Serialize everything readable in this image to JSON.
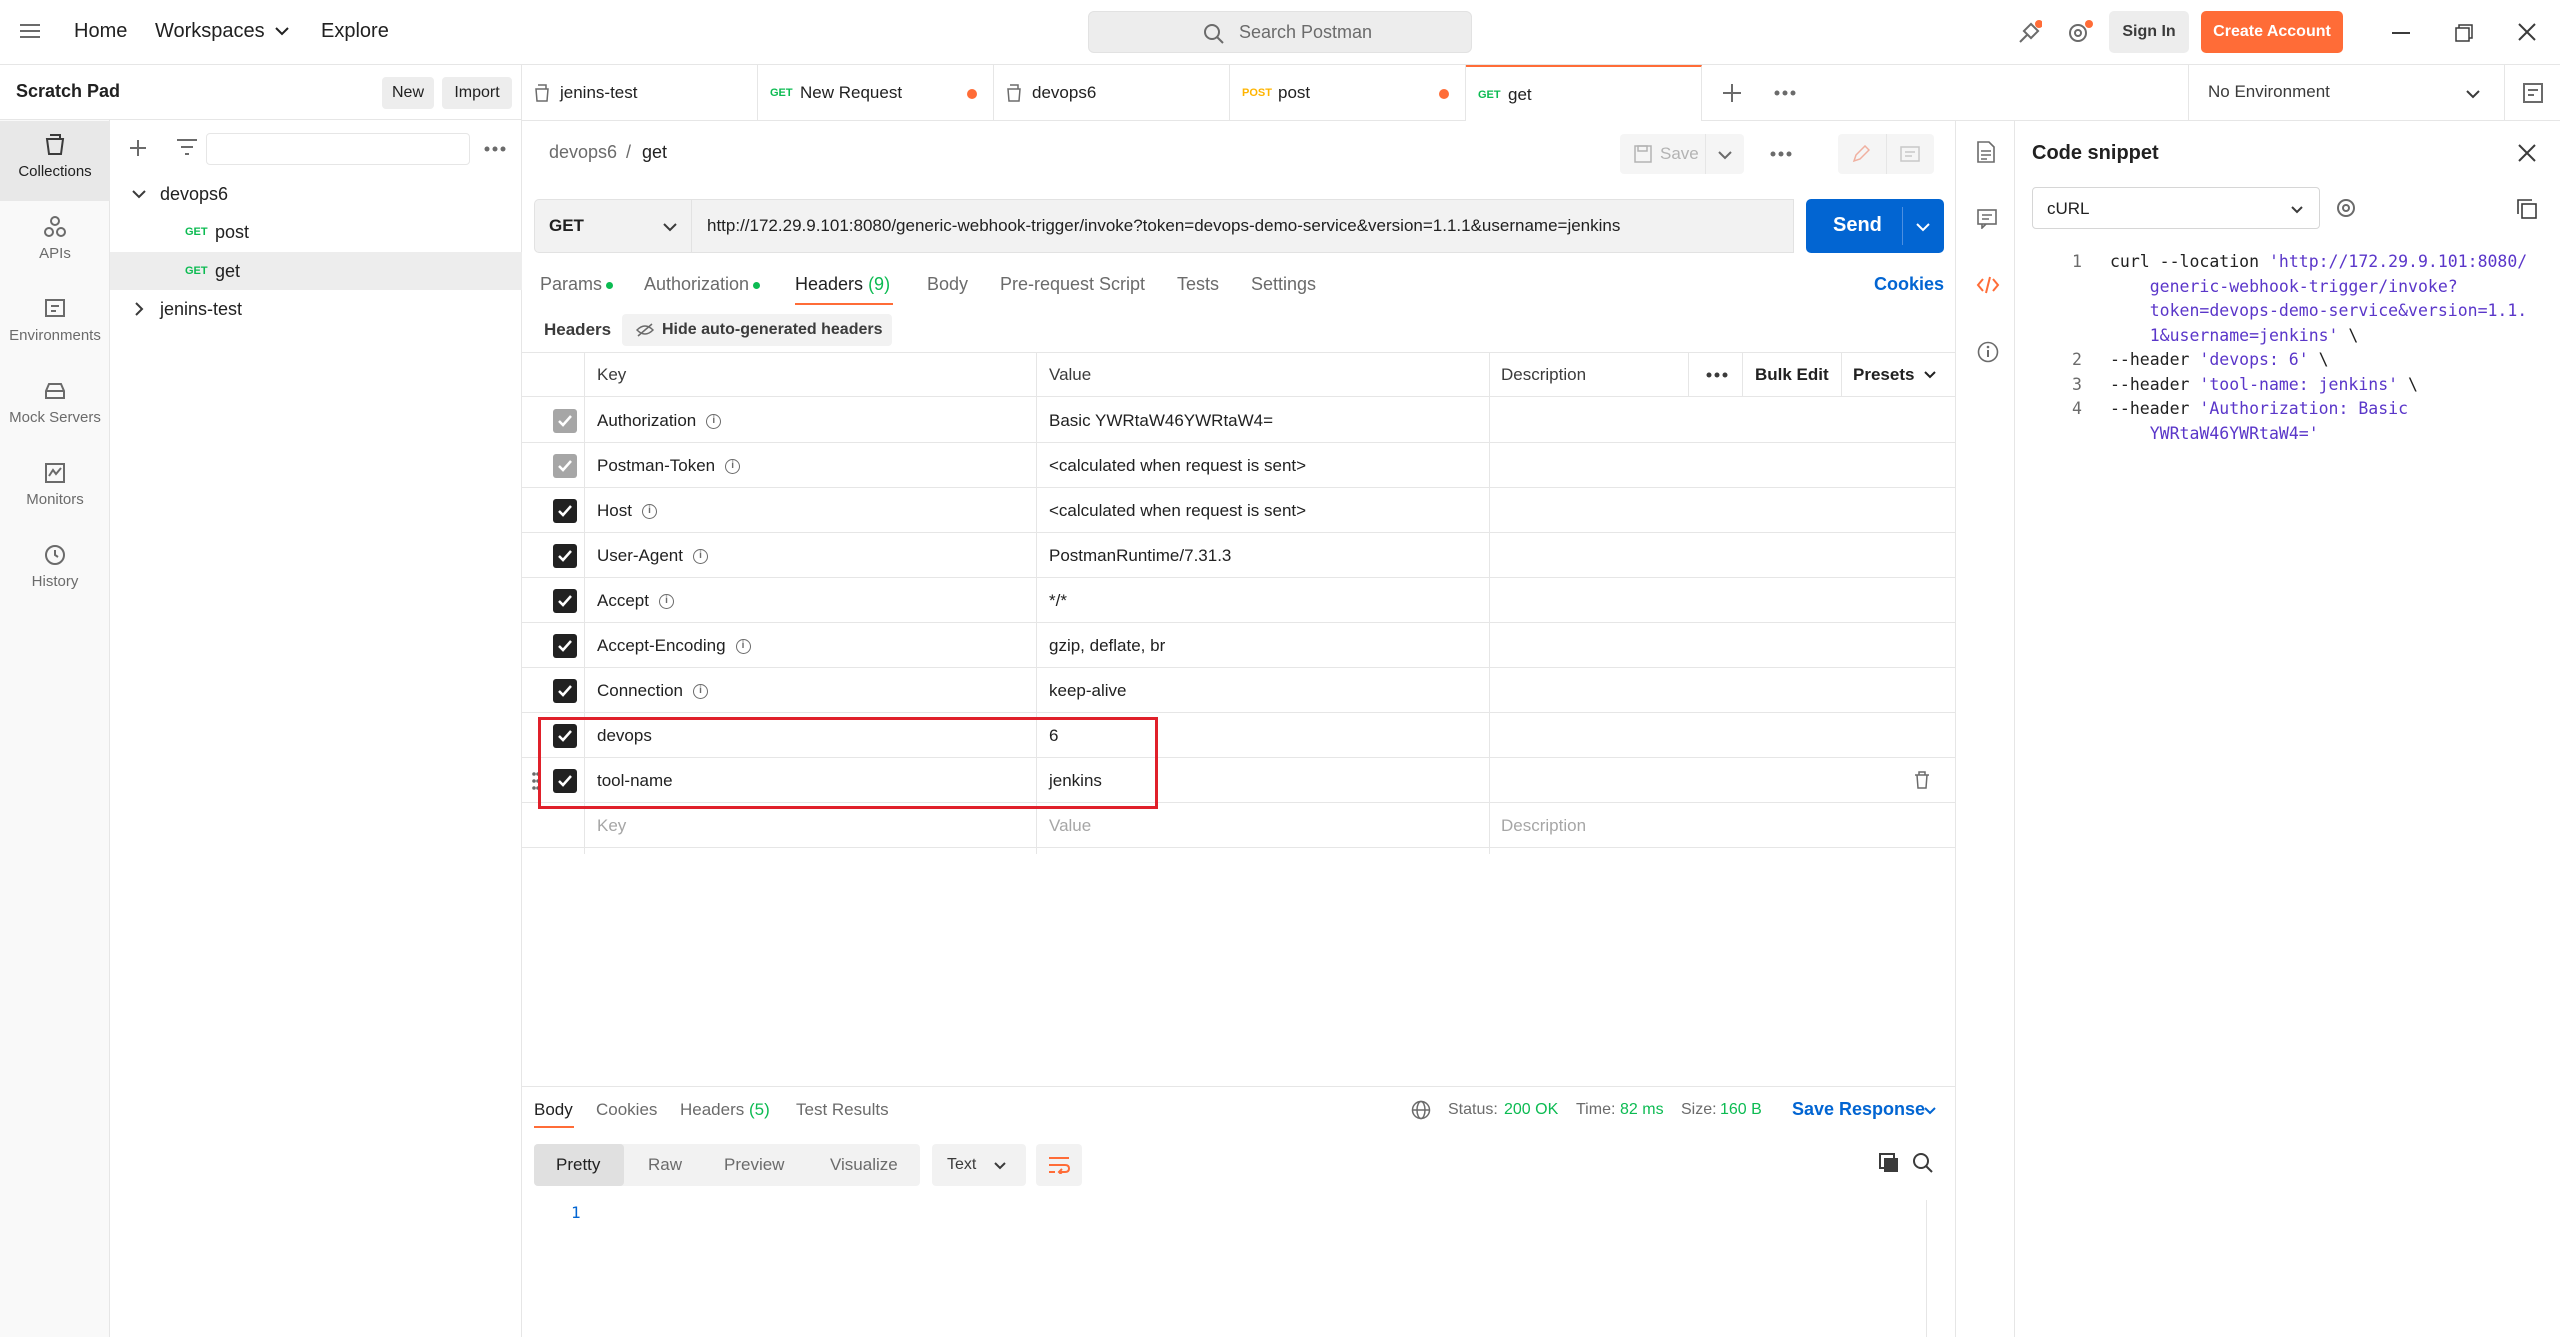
{
  "topbar": {
    "home": "Home",
    "workspaces": "Workspaces",
    "explore": "Explore",
    "search_placeholder": "Search Postman",
    "sign_in": "Sign In",
    "create_account": "Create Account"
  },
  "rail": {
    "items": [
      {
        "label": "Collections",
        "icon": "collections-icon"
      },
      {
        "label": "APIs",
        "icon": "apis-icon"
      },
      {
        "label": "Environments",
        "icon": "environments-icon"
      },
      {
        "label": "Mock Servers",
        "icon": "mock-servers-icon"
      },
      {
        "label": "Monitors",
        "icon": "monitors-icon"
      },
      {
        "label": "History",
        "icon": "history-icon"
      }
    ]
  },
  "sidebar": {
    "title": "Scratch Pad",
    "new_label": "New",
    "import_label": "Import",
    "tree": {
      "collection1": "devops6",
      "req1_method": "GET",
      "req1_name": "post",
      "req2_method": "GET",
      "req2_name": "get",
      "collection2": "jenins-test"
    }
  },
  "tabs": {
    "t1": "jenins-test",
    "t2_method": "GET",
    "t2": "New Request",
    "t3": "devops6",
    "t4_method": "POST",
    "t4": "post",
    "t5_method": "GET",
    "t5": "get",
    "environment": "No Environment"
  },
  "request": {
    "breadcrumb_parent": "devops6",
    "breadcrumb_sep": "/",
    "breadcrumb_current": "get",
    "save_label": "Save",
    "method": "GET",
    "url": "http://172.29.9.101:8080/generic-webhook-trigger/invoke?token=devops-demo-service&version=1.1.1&username=jenkins",
    "send_label": "Send",
    "subtabs": {
      "params": "Params",
      "authorization": "Authorization",
      "headers": "Headers",
      "headers_count": "(9)",
      "body": "Body",
      "prerequest": "Pre-request Script",
      "tests": "Tests",
      "settings": "Settings",
      "cookies": "Cookies"
    },
    "headers_label": "Headers",
    "hide_auto": "Hide auto-generated headers",
    "columns": {
      "key": "Key",
      "value": "Value",
      "description": "Description",
      "bulk_edit": "Bulk Edit",
      "presets": "Presets"
    },
    "rows": [
      {
        "key": "Authorization",
        "value": "Basic YWRtaW46YWRtaW4="
      },
      {
        "key": "Postman-Token",
        "value": "<calculated when request is sent>"
      },
      {
        "key": "Host",
        "value": "<calculated when request is sent>"
      },
      {
        "key": "User-Agent",
        "value": "PostmanRuntime/7.31.3"
      },
      {
        "key": "Accept",
        "value": "*/*"
      },
      {
        "key": "Accept-Encoding",
        "value": "gzip, deflate, br"
      },
      {
        "key": "Connection",
        "value": "keep-alive"
      },
      {
        "key": "devops",
        "value": "6"
      },
      {
        "key": "tool-name",
        "value": "jenkins"
      }
    ],
    "placeholder_row": {
      "key": "Key",
      "value": "Value",
      "description": "Description"
    }
  },
  "response": {
    "tabs": {
      "body": "Body",
      "cookies": "Cookies",
      "headers": "Headers",
      "headers_count": "(5)",
      "test_results": "Test Results"
    },
    "status_label": "Status:",
    "status": "200 OK",
    "time_label": "Time:",
    "time": "82 ms",
    "size_label": "Size:",
    "size": "160 B",
    "save_response": "Save Response",
    "formats": {
      "pretty": "Pretty",
      "raw": "Raw",
      "preview": "Preview",
      "visualize": "Visualize",
      "type": "Text"
    },
    "line1": "1"
  },
  "snippet": {
    "title": "Code snippet",
    "language": "cURL",
    "lines": [
      {
        "n": "1",
        "pre": "curl --location ",
        "str": "'http://172.29.9.101:8080/"
      },
      {
        "n": "",
        "pre": "    ",
        "str": "generic-webhook-trigger/invoke?"
      },
      {
        "n": "",
        "pre": "    ",
        "str": "token=devops-demo-service&version=1.1."
      },
      {
        "n": "",
        "pre": "    ",
        "str": "1&username=jenkins'",
        "post": " \\"
      },
      {
        "n": "2",
        "pre": "--header ",
        "str": "'devops: 6'",
        "post": " \\"
      },
      {
        "n": "3",
        "pre": "--header ",
        "str": "'tool-name: jenkins'",
        "post": " \\"
      },
      {
        "n": "4",
        "pre": "--header ",
        "str": "'Authorization: Basic"
      },
      {
        "n": "",
        "pre": "    ",
        "str": "YWRtaW46YWRtaW4='"
      }
    ]
  },
  "colors": {
    "accent": "#ff6c37",
    "send": "#0265d2",
    "highlight_box": "#e0202a",
    "status_ok": "#0cbb52"
  }
}
